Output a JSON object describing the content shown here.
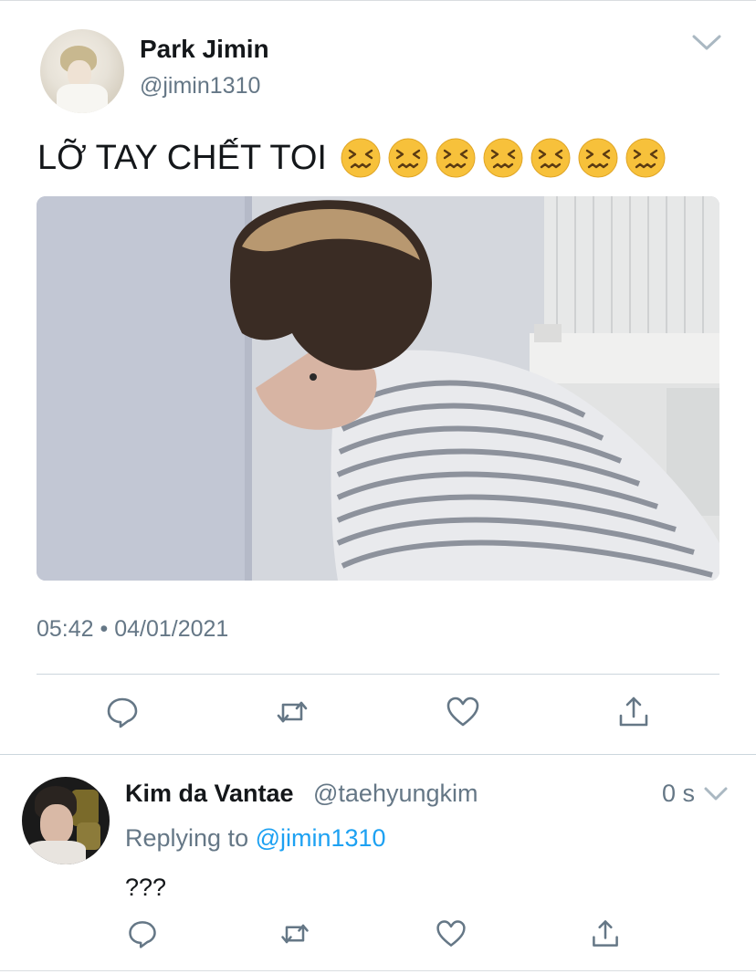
{
  "tweet": {
    "author_name": "Park Jimin",
    "author_handle": "@jimin1310",
    "text": "LỠ TAY CHẾT TOI",
    "emoji_count": 7,
    "emoji_name": "confounded-face-icon",
    "timestamp": "05:42 • 04/01/2021",
    "actions": [
      "reply-icon",
      "retweet-icon",
      "like-icon",
      "share-icon"
    ]
  },
  "reply": {
    "author_name": "Kim da Vantae",
    "author_handle": "@taehyungkim",
    "time": "0 s",
    "replying_prefix": "Replying to ",
    "replying_to": "@jimin1310",
    "text": "???",
    "actions": [
      "reply-icon",
      "retweet-icon",
      "like-icon",
      "share-icon"
    ]
  },
  "colors": {
    "text_primary": "#14171a",
    "text_secondary": "#657786",
    "link": "#1da1f2",
    "divider": "#ccd6dd",
    "emoji_face": "#f7c13b"
  }
}
